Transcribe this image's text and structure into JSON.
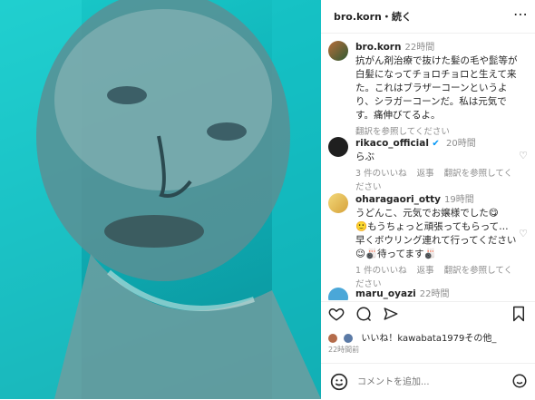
{
  "header": {
    "username": "bro.korn",
    "follow_label": "・続く"
  },
  "caption": {
    "username": "bro.korn",
    "time": "22時間",
    "text": "抗がん剤治療で抜けた髪の毛や髭等が白髪になってチョロチョロと生えて来た。これはブラザーコーンというより、シラガーコーンだ。私は元気です。痛伸びてるよ。",
    "translate": "翻訳を参照してください"
  },
  "comments": [
    {
      "username": "rikaco_official",
      "time": "20時間",
      "text": "らぶ",
      "likes": "3 件のいいね",
      "reply": "返事",
      "translate": "翻訳を参照してください"
    },
    {
      "username": "oharagaori_otty",
      "time": "19時間",
      "text": "うどんこ、元気でお嬢様でした😋\n🙂もうちょっと頑張ってもらって…\n早くボウリング連れて行ってください😉🎳待ってます🎳",
      "likes": "1 件のいいね",
      "reply": "返事",
      "translate": "翻訳を参照してください"
    },
    {
      "username": "maru_oyazi",
      "time": "22時間"
    }
  ],
  "likes_line": "いいね！kawabata1979その他_",
  "timestamp": "22時間前",
  "comment_placeholder": "コメントを追加..."
}
